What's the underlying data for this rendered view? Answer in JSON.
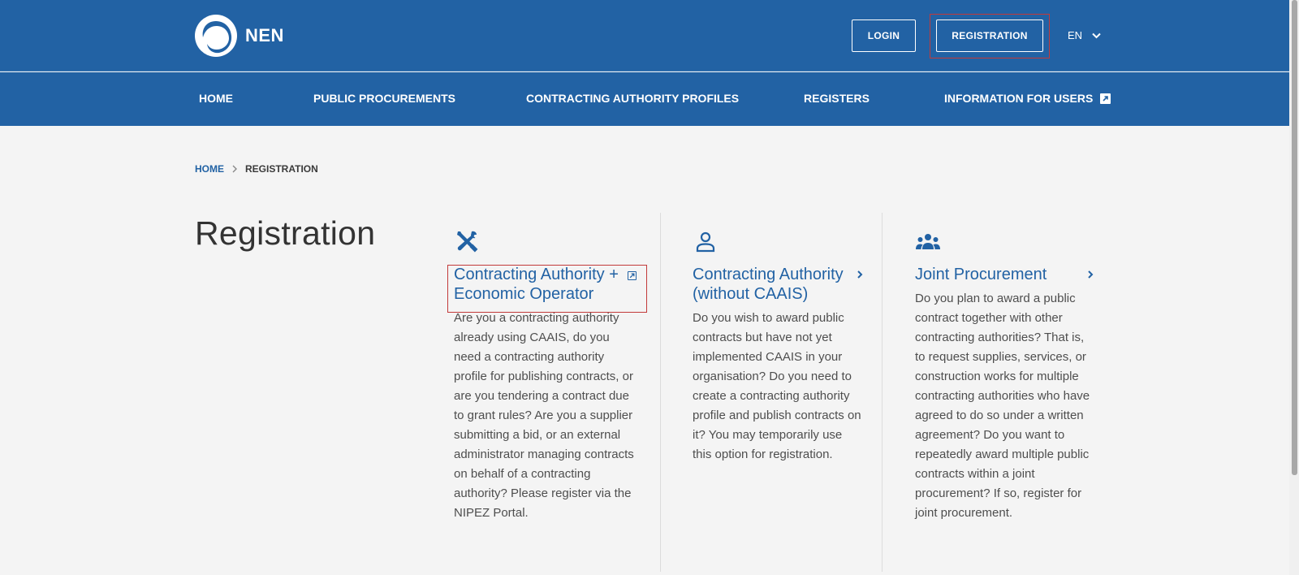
{
  "header": {
    "logo_text": "NEN",
    "login_label": "LOGIN",
    "registration_label": "REGISTRATION",
    "language": "EN"
  },
  "nav": {
    "items": [
      {
        "label": "HOME"
      },
      {
        "label": "PUBLIC PROCUREMENTS"
      },
      {
        "label": "CONTRACTING AUTHORITY PROFILES"
      },
      {
        "label": "REGISTERS"
      },
      {
        "label": "INFORMATION FOR USERS",
        "external": true
      }
    ]
  },
  "breadcrumb": {
    "home": "HOME",
    "current": "REGISTRATION"
  },
  "page": {
    "title": "Registration"
  },
  "cards": [
    {
      "icon": "tools-icon",
      "title": "Contracting Authority + Economic Operator",
      "link_type": "external",
      "text": "Are you a contracting authority already using CAAIS, do you need a contracting authority profile for publishing contracts, or are you tendering a contract due to grant rules? Are you a supplier submitting a bid, or an external administrator managing contracts on behalf of a contracting authority? Please register via the NIPEZ Portal."
    },
    {
      "icon": "person-icon",
      "title": "Contracting Authority (without CAAIS)",
      "link_type": "arrow",
      "text": "Do you wish to award public contracts but have not yet implemented CAAIS in your organisation? Do you need to create a contracting authority profile and publish contracts on it? You may temporarily use this option for registration."
    },
    {
      "icon": "group-icon",
      "title": "Joint Procurement",
      "link_type": "arrow",
      "text": "Do you plan to award a public contract together with other contracting authorities? That is, to request supplies, services, or construction works for multiple contracting authorities who have agreed to do so under a written agreement? Do you want to repeatedly award multiple public contracts within a joint procurement? If so, register for joint procurement."
    }
  ],
  "colors": {
    "brand": "#2262a4",
    "background": "#f4f4f4",
    "highlight": "#c23a3a"
  }
}
